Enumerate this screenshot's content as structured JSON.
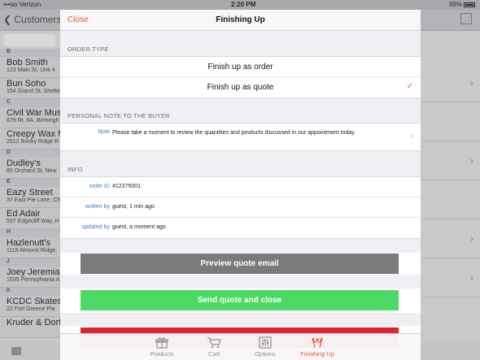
{
  "status_bar": {
    "carrier": "•••oo Verizon",
    "time": "2:20 PM",
    "battery": "99%"
  },
  "background": {
    "back_label": "Customers U",
    "groups": [
      {
        "letter": "B",
        "items": [
          {
            "name": "Bob Smith",
            "addr": "123 Main St, Unit 4"
          },
          {
            "name": "Bun Soho",
            "addr": "154 Grand St, Shelte"
          }
        ]
      },
      {
        "letter": "C",
        "items": [
          {
            "name": "Civil War Mus",
            "addr": "679 Rt. 6A, Birmingh"
          },
          {
            "name": "Creepy Wax M",
            "addr": "2512 Rocky Ridge R"
          }
        ]
      },
      {
        "letter": "D",
        "items": [
          {
            "name": "Dudley's",
            "addr": "85 Orchard St, New"
          }
        ]
      },
      {
        "letter": "E",
        "items": [
          {
            "name": "Eazy Street",
            "addr": "37 East Pie Lane, Ch"
          },
          {
            "name": "Ed Adair",
            "addr": "507 Edgecliff Way, H"
          }
        ]
      },
      {
        "letter": "H",
        "items": [
          {
            "name": "Hazlenutt's",
            "addr": "1119 Almond Ridge,"
          }
        ]
      },
      {
        "letter": "J",
        "items": [
          {
            "name": "Joey Jeremiah",
            "addr": "1535 Pennsylvania A"
          }
        ]
      },
      {
        "letter": "K",
        "items": [
          {
            "name": "KCDC Skatesh",
            "addr": "22 Fort Greene Pla"
          },
          {
            "name": "Kruder & Dorf",
            "addr": ""
          }
        ]
      }
    ]
  },
  "modal": {
    "close_label": "Close",
    "title": "Finishing Up",
    "order_type": {
      "header": "ORDER TYPE",
      "options": [
        {
          "label": "Finish up as order",
          "selected": false
        },
        {
          "label": "Finish up as quote",
          "selected": true
        }
      ],
      "check_glyph": "✓"
    },
    "note": {
      "header": "PERSONAL NOTE TO THE BUYER",
      "label": "Note",
      "text": "Please take a moment to review the quantities and products discussed in our appointment today."
    },
    "info": {
      "header": "INFO",
      "rows": [
        {
          "label": "order ID",
          "value": "#12375001"
        },
        {
          "label": "written by",
          "value": "guest, 1 min ago"
        },
        {
          "label": "updated by",
          "value": "guest, a moment ago"
        }
      ]
    },
    "buttons": {
      "preview": "Preview quote email",
      "send": "Send quote and close",
      "red": ""
    }
  },
  "tabbar": {
    "accent": "#f0562b",
    "tabs": [
      {
        "label": "Products",
        "icon": "gift-icon",
        "active": false
      },
      {
        "label": "Cart",
        "icon": "cart-icon",
        "active": false
      },
      {
        "label": "Options",
        "icon": "sliders-icon",
        "active": false
      },
      {
        "label": "Finishing Up",
        "icon": "checkered-flags-icon",
        "active": true
      }
    ]
  }
}
